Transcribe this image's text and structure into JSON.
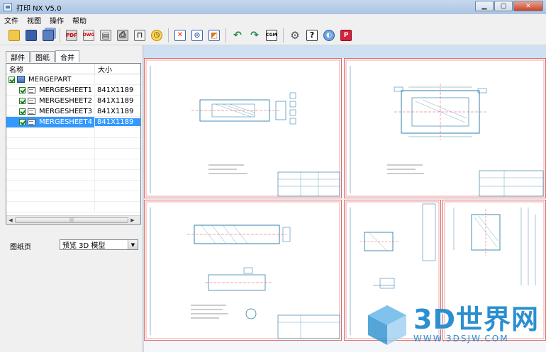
{
  "window": {
    "title": "打印 NX V5.0"
  },
  "menu": [
    "文件",
    "视图",
    "操作",
    "帮助"
  ],
  "tabs": [
    {
      "label": "部件",
      "active": false
    },
    {
      "label": "图纸",
      "active": false
    },
    {
      "label": "合并",
      "active": true
    }
  ],
  "tree": {
    "columns": [
      "名称",
      "大小"
    ],
    "root": {
      "label": "MERGEPART"
    },
    "items": [
      {
        "label": "MERGESHEET1",
        "size": "841X1189",
        "selected": false
      },
      {
        "label": "MERGESHEET2",
        "size": "841X1189",
        "selected": false
      },
      {
        "label": "MERGESHEET3",
        "size": "841X1189",
        "selected": false
      },
      {
        "label": "MERGESHEET4",
        "size": "841X1189",
        "selected": true
      }
    ]
  },
  "page_select": {
    "label": "图纸页",
    "value": "预览 3D 模型"
  },
  "toolbar_icons": [
    "open-icon",
    "save-icon",
    "save-all-icon",
    "sep",
    "pdf-icon",
    "dwg-icon",
    "print-icon",
    "printer-icon",
    "plotter-icon",
    "clock-icon",
    "sep",
    "zoom-fit-icon",
    "zoom-window-icon",
    "zoom-region-icon",
    "sep",
    "rotate-left-icon",
    "rotate-right-icon",
    "cgm-icon",
    "sep",
    "settings-icon",
    "help-icon",
    "web-icon",
    "app-icon"
  ],
  "toolbar_text": {
    "cgm": "CGM"
  },
  "watermark": {
    "big": "3D世界网",
    "small": "WWW.3DSJW.COM"
  },
  "colors": {
    "accent": "#3399ff",
    "drawing": "#1a6fa0",
    "sheet_border": "#e06a6a",
    "watermark": "#2b8fd0"
  }
}
